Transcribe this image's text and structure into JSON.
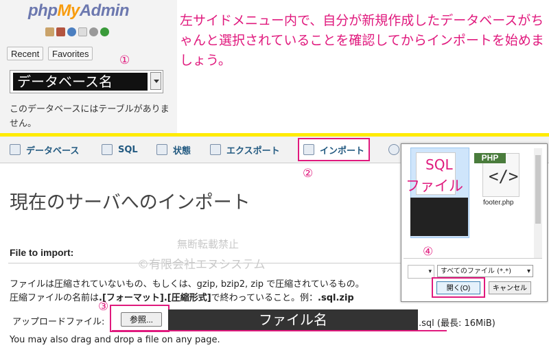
{
  "sidebar": {
    "logo": {
      "php": "php",
      "my": "My",
      "admin": "Admin"
    },
    "recent_label": "Recent",
    "favorites_label": "Favorites",
    "db_select_value": "データベース名",
    "no_tables_text": "このデータベースにはテーブルがありません。"
  },
  "annotation": {
    "note": "左サイドメニュー内で、自分が新規作成したデータベースがちゃんと選択されていることを確認してからインポートを始めましょう。",
    "step1": "①",
    "step2": "②",
    "step3": "③",
    "step4": "④"
  },
  "tabs": [
    {
      "label": "データベース"
    },
    {
      "label": "SQL"
    },
    {
      "label": "状態"
    },
    {
      "label": "エクスポート"
    },
    {
      "label": "インポート"
    }
  ],
  "main": {
    "title": "現在のサーバへのインポート",
    "file_to_import": "File to import:",
    "watermark_line1": "無断転載禁止",
    "watermark_line2": "©有限会社エヌシステム",
    "compress_note": "ファイルは圧縮されていないもの、もしくは、gzip, bzip2, zip で圧縮されているもの。",
    "compress_name_prefix": "圧縮ファイルの名前は",
    "compress_name_format": ".[フォーマット].[圧縮形式]",
    "compress_name_suffix": "で終わっていること。例：",
    "compress_name_example": ".sql.zip",
    "upload_label": "アップロードファイル:",
    "browse_label": "参照...",
    "file_name": "ファイル名",
    "file_suffix": ".sql (最長: 16MiB)",
    "drag_drop": "You may also drag and drop a file on any page."
  },
  "dialog": {
    "sql_file_name_line1": "SQL",
    "sql_file_name_line2": "ファイル",
    "php_badge": "PHP",
    "php_symbol": "</>",
    "php_file_name": "footer.php",
    "filter_value": "すべてのファイル (*.*)",
    "open_label": "開く(O)",
    "cancel_label": "キャンセル"
  },
  "colors": {
    "accent": "#e0197d",
    "highlight_bar": "#ffeb00",
    "tab_text": "#235a81"
  }
}
